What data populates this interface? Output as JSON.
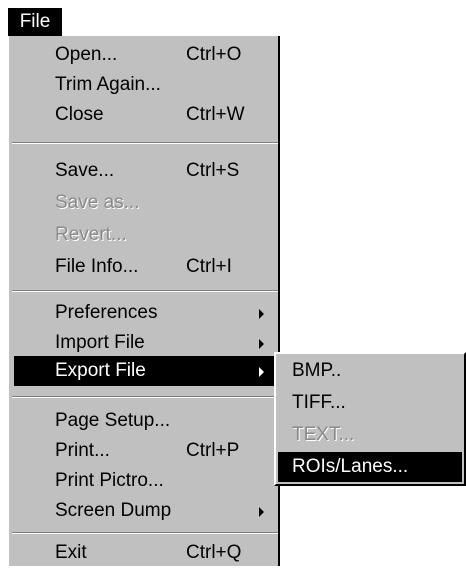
{
  "menubar": {
    "title": "File"
  },
  "file_menu": {
    "items": [
      {
        "label": "Open...",
        "shortcut": "Ctrl+O"
      },
      {
        "label": "Trim Again...",
        "shortcut": ""
      },
      {
        "label": "Close",
        "shortcut": "Ctrl+W"
      },
      {
        "label": "Save...",
        "shortcut": "Ctrl+S"
      },
      {
        "label": "Save as...",
        "shortcut": "",
        "disabled": true
      },
      {
        "label": "Revert...",
        "shortcut": "",
        "disabled": true
      },
      {
        "label": "File Info...",
        "shortcut": "Ctrl+I"
      },
      {
        "label": "Preferences",
        "shortcut": "",
        "submenu": true
      },
      {
        "label": "Import File",
        "shortcut": "",
        "submenu": true
      },
      {
        "label": "Export File",
        "shortcut": "",
        "submenu": true,
        "selected": true
      },
      {
        "label": "Page Setup...",
        "shortcut": ""
      },
      {
        "label": "Print...",
        "shortcut": "Ctrl+P"
      },
      {
        "label": "Print Pictro...",
        "shortcut": ""
      },
      {
        "label": "Screen Dump",
        "shortcut": "",
        "submenu": true
      },
      {
        "label": "Exit",
        "shortcut": "Ctrl+Q"
      }
    ]
  },
  "export_submenu": {
    "items": [
      {
        "label": "BMP.."
      },
      {
        "label": "TIFF..."
      },
      {
        "label": "TEXT...",
        "disabled": true
      },
      {
        "label": "ROIs/Lanes...",
        "selected": true
      }
    ]
  },
  "colors": {
    "menu_background": "#c0c0c0",
    "highlight": "#000000",
    "highlight_text": "#ffffff",
    "disabled_text": "#8a8a8a"
  }
}
